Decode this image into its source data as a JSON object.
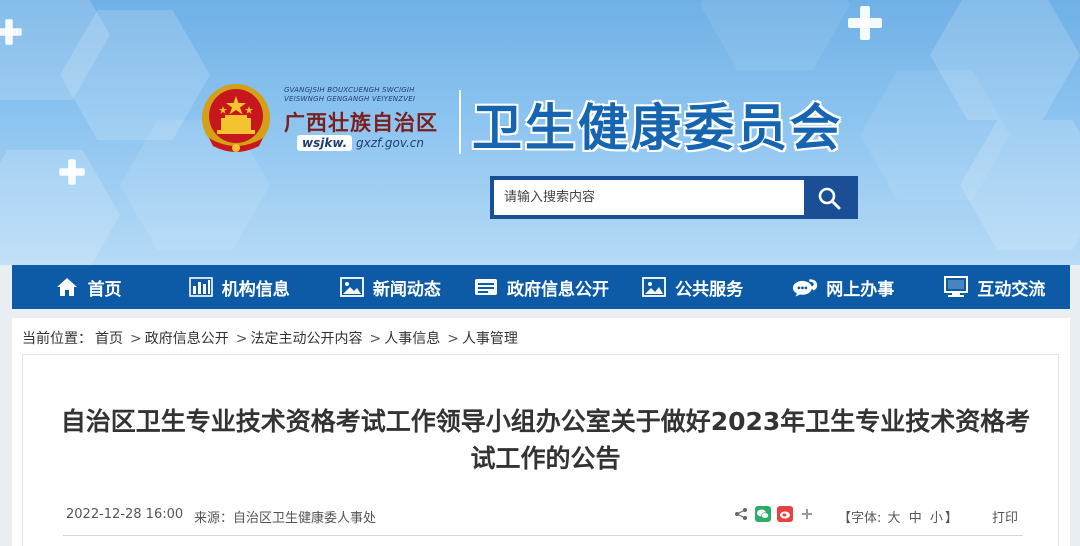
{
  "header": {
    "zhuang_line1": "GVANGJSIH BOUXCUENGH SWCIGIH",
    "zhuang_line2": "VEISWNGH GENGANGH VEIYENZVEI",
    "region_name": "广西壮族自治区",
    "domain_prefix": "wsjkw.",
    "domain_suffix": "gxzf.gov.cn",
    "site_title": "卫生健康委员会"
  },
  "search": {
    "placeholder": "请输入搜索内容",
    "icon": "search-icon"
  },
  "nav": {
    "items": [
      {
        "label": "首页",
        "icon": "home-icon"
      },
      {
        "label": "机构信息",
        "icon": "bar-chart-icon"
      },
      {
        "label": "新闻动态",
        "icon": "image-icon"
      },
      {
        "label": "政府信息公开",
        "icon": "document-icon"
      },
      {
        "label": "公共服务",
        "icon": "picture-icon"
      },
      {
        "label": "网上办事",
        "icon": "chat-icon"
      },
      {
        "label": "互动交流",
        "icon": "monitor-icon"
      }
    ]
  },
  "breadcrumb": {
    "prefix": "当前位置：",
    "items": [
      "首页",
      "政府信息公开",
      "法定主动公开内容",
      "人事信息",
      "人事管理"
    ],
    "separator": ">"
  },
  "article": {
    "title": "自治区卫生专业技术资格考试工作领导小组办公室关于做好2023年卫生专业技术资格考试工作的公告",
    "date": "2022-12-28 16:00",
    "source_label": "来源：",
    "source": "自治区卫生健康委人事处",
    "font_label": "【字体:",
    "font_sizes": [
      "大",
      "中",
      "小"
    ],
    "font_close": "】",
    "print_label": "打印"
  },
  "colors": {
    "nav_bg": "#0d5ba7",
    "title_blue": "#1565b0",
    "search_border": "#1a4f96"
  }
}
